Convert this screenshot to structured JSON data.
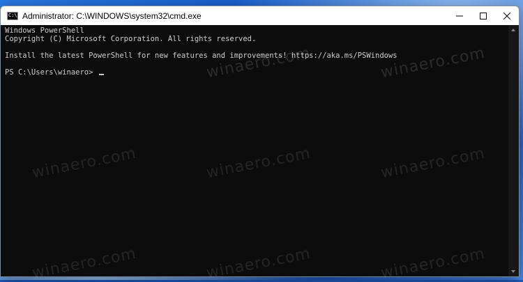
{
  "window": {
    "title": "Administrator: C:\\WINDOWS\\system32\\cmd.exe",
    "icon": "console-icon",
    "icon_glyph": "C:\\"
  },
  "console": {
    "lines": [
      "Windows PowerShell",
      "Copyright (C) Microsoft Corporation. All rights reserved.",
      "",
      "Install the latest PowerShell for new features and improvements! https://aka.ms/PSWindows",
      "",
      "PS C:\\Users\\winaero> "
    ]
  },
  "watermark": {
    "text": "winaero.com"
  },
  "colors": {
    "console_bg": "#0c0c0c",
    "console_fg": "#cccccc",
    "titlebar_bg": "#ffffff",
    "desktop_accent": "#1f5fc4"
  }
}
